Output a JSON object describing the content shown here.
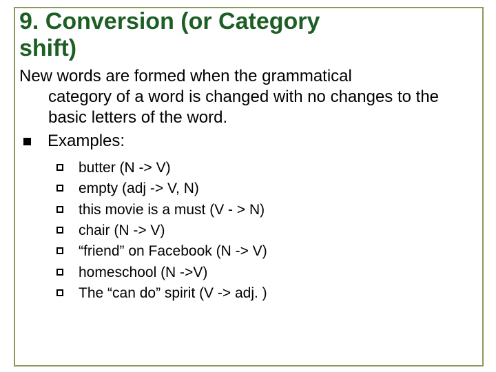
{
  "title_line1": "9.  Conversion (or Category",
  "title_line2": "shift)",
  "intro_first": "New words are formed when the grammatical",
  "intro_rest": "category of a word is changed with no changes to the basic letters of the word.",
  "examples_label": "Examples:",
  "examples": [
    "butter (N -> V)",
    "empty (adj -> V, N)",
    "this movie is a must (V - > N)",
    "chair (N -> V)",
    "“friend” on Facebook (N -> V)",
    "homeschool (N ->V)",
    "The “can do” spirit (V -> adj. )"
  ]
}
